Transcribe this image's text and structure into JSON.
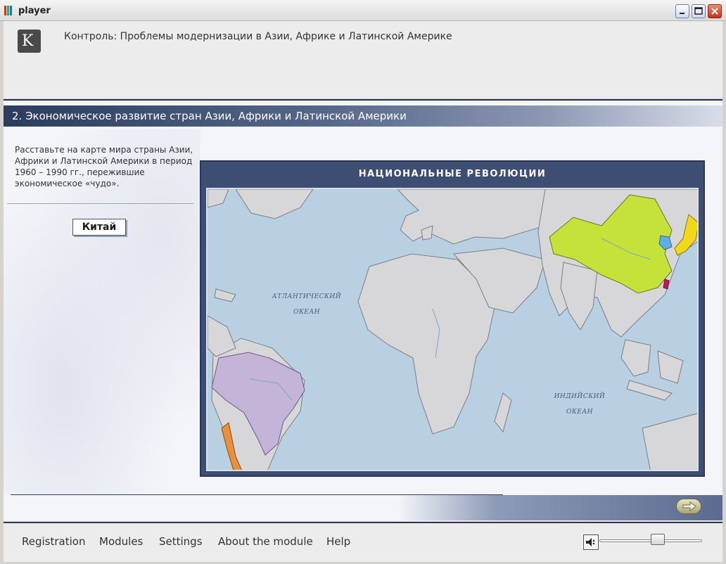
{
  "window": {
    "title": "player"
  },
  "header": {
    "course_title": "Контроль: Проблемы модернизации в Азии, Африке и Латинской Америке",
    "logo_letter": "K"
  },
  "section": {
    "title": "2. Экономическое развитие стран Азии, Африки и Латинской Америки"
  },
  "task": {
    "instruction": "Расставьте на карте мира страны Азии, Африки и Латинской Америки в период  1960 – 1990 гг., пережившие экономическое «чудо».",
    "country_button": "Китай"
  },
  "map": {
    "title": "НАЦИОНАЛЬНЫЕ РЕВОЛЮЦИИ",
    "ocean_labels": {
      "atlantic_1": "АТЛАНТИЧЕСКИЙ",
      "atlantic_2": "ОКЕАН",
      "indian_1": "ИНДИЙСКИЙ",
      "indian_2": "ОКЕАН"
    },
    "colors": {
      "water": "#b9d0e2",
      "land": "#d7d7d9",
      "china": "#c5e23a",
      "japan": "#f2d81a",
      "korea": "#5fb0e2",
      "taiwan": "#c2185b",
      "brazil": "#c4b5d8",
      "chile": "#e8913a"
    }
  },
  "footer": {
    "menu": [
      "Registration",
      "Modules",
      "Settings",
      "About the module",
      "Help"
    ],
    "volume_level": 0.5
  },
  "icons": {
    "app": "player-icon",
    "minimize": "minimize-icon",
    "maximize": "maximize-icon",
    "close": "close-icon",
    "next": "arrow-right-icon",
    "sound": "speaker-icon"
  }
}
